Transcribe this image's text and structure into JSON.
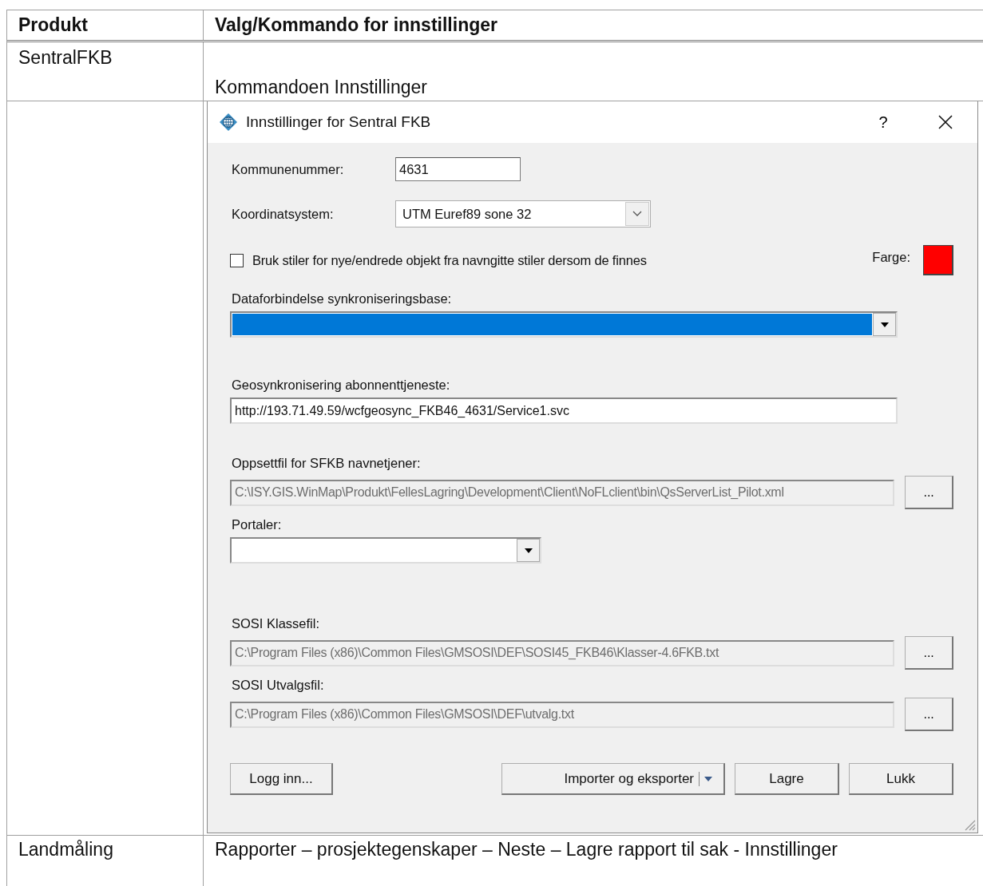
{
  "table": {
    "columns": [
      "Produkt",
      "Valg/Kommando for innstillinger"
    ],
    "rows": [
      {
        "kind": "text",
        "product": "SentralFKB",
        "command": "Kommandoen Innstillinger"
      },
      {
        "kind": "dialog"
      },
      {
        "kind": "text",
        "product": "Landmåling",
        "command": "Rapporter – prosjektegenskaper – Neste – Lagre rapport til sak - Innstillinger"
      }
    ]
  },
  "dialog": {
    "title": "Innstillinger for Sentral FKB",
    "help": "?",
    "fields": [
      {
        "kind": "inline_input",
        "label": "Kommunenummer:",
        "value": "4631"
      },
      {
        "kind": "inline_combo",
        "label": "Koordinatsystem:",
        "value": "UTM Euref89 sone 32"
      },
      {
        "kind": "checkbox",
        "label": "Bruk stiler for nye/endrede objekt fra navngitte stiler dersom de finnes",
        "checked": false,
        "color_label": "Farge:",
        "color": "#ff0000"
      },
      {
        "kind": "dropdown",
        "label": "Dataforbindelse synkroniseringsbase:",
        "highlighted": true
      },
      {
        "kind": "input",
        "label": "Geosynkronisering abonnenttjeneste:",
        "value": "http://193.71.49.59/wcfgeosync_FKB46_4631/Service1.svc"
      },
      {
        "kind": "path",
        "label": "Oppsettfil for SFKB navnetjener:",
        "value": "C:\\ISY.GIS.WinMap\\Produkt\\FellesLagring\\Development\\Client\\NoFLclient\\bin\\QsServerList_Pilot.xml",
        "browse": "..."
      },
      {
        "kind": "small_dropdown",
        "label": "Portaler:",
        "highlighted": false
      },
      {
        "kind": "path",
        "label": "SOSI Klassefil:",
        "value": "C:\\Program Files (x86)\\Common Files\\GMSOSI\\DEF\\SOSI45_FKB46\\Klasser-4.6FKB.txt",
        "browse": "..."
      },
      {
        "kind": "path",
        "label": "SOSI Utvalgsfil:",
        "value": "C:\\Program Files (x86)\\Common Files\\GMSOSI\\DEF\\utvalg.txt",
        "browse": "..."
      }
    ],
    "buttons": [
      {
        "kind": "left",
        "label": "Logg inn..."
      },
      {
        "kind": "split",
        "label": "Importer og eksporter"
      },
      {
        "kind": "plain",
        "label": "Lagre"
      },
      {
        "kind": "plain",
        "label": "Lukk"
      }
    ]
  }
}
